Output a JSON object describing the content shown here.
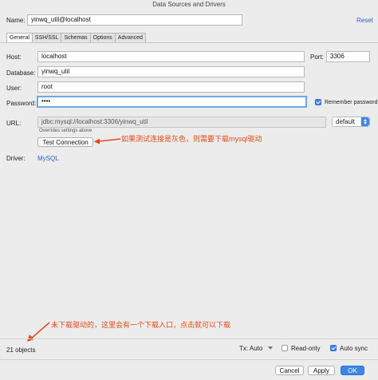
{
  "window": {
    "title": "Data Sources and Drivers"
  },
  "header": {
    "name_label": "Name:",
    "name_value": "yinwq_util@localhost",
    "reset_label": "Reset"
  },
  "tabs": [
    {
      "label": "General"
    },
    {
      "label": "SSH/SSL"
    },
    {
      "label": "Schemas"
    },
    {
      "label": "Options"
    },
    {
      "label": "Advanced"
    }
  ],
  "form": {
    "host_label": "Host:",
    "host_value": "localhost",
    "port_label": "Port:",
    "port_value": "3306",
    "database_label": "Database:",
    "database_value": "yinwq_util",
    "user_label": "User:",
    "user_value": "root",
    "password_label": "Password:",
    "password_value": "••••",
    "remember_label": "Remember password",
    "remember_checked": true,
    "url_label": "URL:",
    "url_value": "jdbc:mysql://localhost:3306/yinwq_util",
    "url_hint": "Overrides settings above",
    "url_mode": "default",
    "test_button": "Test Connection",
    "driver_label": "Driver:",
    "driver_value": "MySQL"
  },
  "annotations": {
    "test_note": "如果测试连接是灰色，则需要下载mysql驱动",
    "bottom_note": "未下载驱动的，这里会有一个下载入口，点击就可以下载"
  },
  "footer": {
    "object_count": "21 objects",
    "tx_label": "Tx: Auto",
    "readonly_label": "Read-only",
    "readonly_checked": false,
    "autosync_label": "Auto sync",
    "autosync_checked": true
  },
  "actions": {
    "cancel": "Cancel",
    "apply": "Apply",
    "ok": "OK"
  },
  "colors": {
    "accent": "#3b86e8",
    "note": "#e04b17",
    "link": "#2a63c7",
    "focus": "#6fa7e8"
  }
}
